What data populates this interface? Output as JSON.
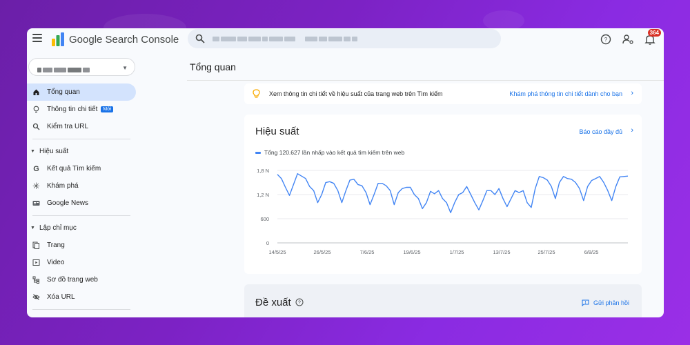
{
  "app": {
    "title": "Google Search Console"
  },
  "search": {
    "placeholder": ""
  },
  "header": {
    "notification_count": "364"
  },
  "sidebar": {
    "items": [
      {
        "label": "Tổng quan",
        "icon": "home-icon",
        "active": true
      },
      {
        "label": "Thông tin chi tiết",
        "icon": "lightbulb-icon",
        "badge": "Mới"
      },
      {
        "label": "Kiểm tra URL",
        "icon": "search-icon"
      }
    ],
    "sections": [
      {
        "label": "Hiệu suất",
        "items": [
          {
            "label": "Kết quả Tìm kiếm",
            "icon": "google-g-icon"
          },
          {
            "label": "Khám phá",
            "icon": "asterisk-icon"
          },
          {
            "label": "Google News",
            "icon": "google-news-icon"
          }
        ]
      },
      {
        "label": "Lập chỉ mục",
        "items": [
          {
            "label": "Trang",
            "icon": "pages-icon"
          },
          {
            "label": "Video",
            "icon": "video-icon"
          },
          {
            "label": "Sơ đồ trang web",
            "icon": "sitemap-icon"
          },
          {
            "label": "Xóa URL",
            "icon": "eye-off-icon"
          }
        ]
      }
    ]
  },
  "main": {
    "title": "Tổng quan",
    "banner": {
      "text": "Xem thông tin chi tiết về hiệu suất của trang web trên Tìm kiếm",
      "link": "Khám phá thông tin chi tiết dành cho bạn"
    },
    "performance": {
      "title": "Hiệu suất",
      "link": "Báo cáo đầy đủ",
      "legend": "Tổng 120.627 lần nhấp vào kết quả tìm kiếm trên web"
    },
    "suggestions": {
      "title": "Đề xuất",
      "feedback": "Gửi phản hồi"
    }
  },
  "colors": {
    "accent": "#1a73e8",
    "line": "#4285f4",
    "active_nav": "#d3e3fd"
  },
  "chart_data": {
    "type": "line",
    "y_ticks": [
      "1,8 N",
      "1,2 N",
      "600",
      "0"
    ],
    "y_tick_values": [
      1800,
      1200,
      600,
      0
    ],
    "ylim": [
      0,
      1800
    ],
    "x_ticks": [
      "14/5/25",
      "26/5/25",
      "7/6/25",
      "19/6/25",
      "1/7/25",
      "13/7/25",
      "25/7/25",
      "6/8/25"
    ],
    "series": [
      {
        "values": [
          1700,
          1600,
          1380,
          1180,
          1450,
          1720,
          1660,
          1600,
          1400,
          1300,
          1000,
          1200,
          1500,
          1520,
          1480,
          1300,
          1000,
          1300,
          1560,
          1580,
          1450,
          1420,
          1250,
          950,
          1200,
          1480,
          1480,
          1420,
          1300,
          950,
          1250,
          1350,
          1380,
          1380,
          1200,
          1100,
          850,
          1000,
          1280,
          1220,
          1300,
          1100,
          1000,
          750,
          1000,
          1200,
          1250,
          1400,
          1200,
          1000,
          820,
          1050,
          1300,
          1300,
          1200,
          1350,
          1100,
          900,
          1100,
          1300,
          1250,
          1300,
          1000,
          880,
          1350,
          1650,
          1620,
          1560,
          1400,
          1100,
          1500,
          1650,
          1600,
          1580,
          1500,
          1350,
          1050,
          1400,
          1550,
          1600,
          1650,
          1500,
          1300,
          1050,
          1400,
          1640,
          1650,
          1660
        ]
      }
    ]
  }
}
